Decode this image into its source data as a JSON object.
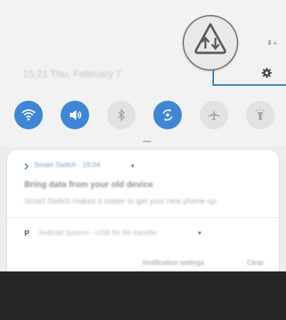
{
  "header": {
    "datetime": "15:21 Thu, February 7",
    "status_icons": "▮ ▴"
  },
  "quick_settings": [
    {
      "name": "wifi",
      "state": "on",
      "icon": "wifi-icon"
    },
    {
      "name": "sound",
      "state": "on",
      "icon": "sound-icon"
    },
    {
      "name": "bluetooth",
      "state": "off",
      "icon": "bluetooth-icon"
    },
    {
      "name": "auto-rotate",
      "state": "on",
      "icon": "auto-rotate-icon"
    },
    {
      "name": "airplane-mode",
      "state": "off",
      "icon": "airplane-icon"
    },
    {
      "name": "flashlight",
      "state": "off",
      "icon": "flashlight-icon"
    }
  ],
  "notifications": {
    "first": {
      "app_line": "Smart Switch · 15:04",
      "title": "Bring data from your old device",
      "body": "Smart Switch makes it easier to get your new phone up"
    },
    "second": {
      "app_letter": "P",
      "text": "Android System · USB for file transfer"
    },
    "actions": {
      "settings_label": "Notification settings",
      "clear_label": "Clear"
    }
  },
  "colors": {
    "accent": "#3f86d6",
    "callout": "#1f78b4",
    "bottom_bar": "#262626"
  }
}
